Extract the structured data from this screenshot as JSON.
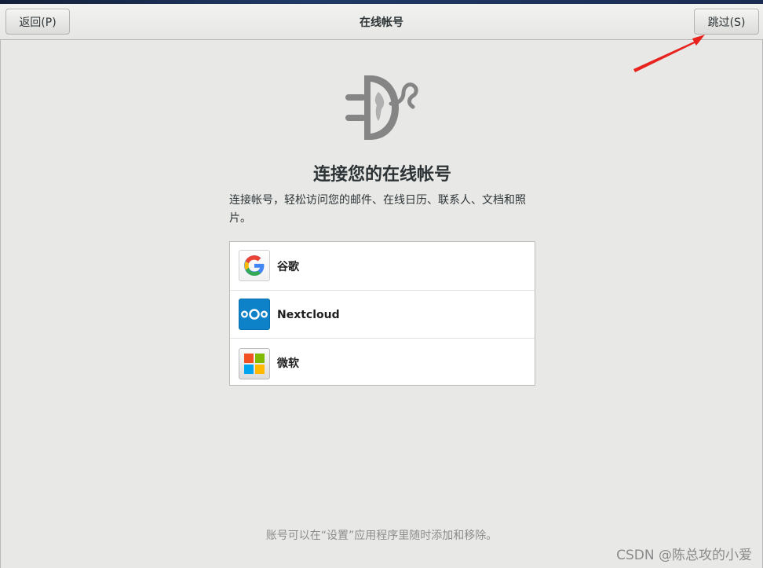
{
  "header": {
    "back_label": "返回(P)",
    "title": "在线帐号",
    "skip_label": "跳过(S)"
  },
  "main": {
    "heading": "连接您的在线帐号",
    "description": "连接帐号，轻松访问您的邮件、在线日历、联系人、文档和照片。",
    "providers": [
      {
        "label": "谷歌",
        "icon": "google-icon"
      },
      {
        "label": "Nextcloud",
        "icon": "nextcloud-icon"
      },
      {
        "label": "微软",
        "icon": "microsoft-icon"
      }
    ],
    "footer": "账号可以在“设置”应用程序里随时添加和移除。"
  },
  "watermark": "CSDN @陈总攻的小爱",
  "colors": {
    "arrow": "#e8231e",
    "nextcloud": "#0e82c8",
    "logo_gray": "#858585"
  }
}
